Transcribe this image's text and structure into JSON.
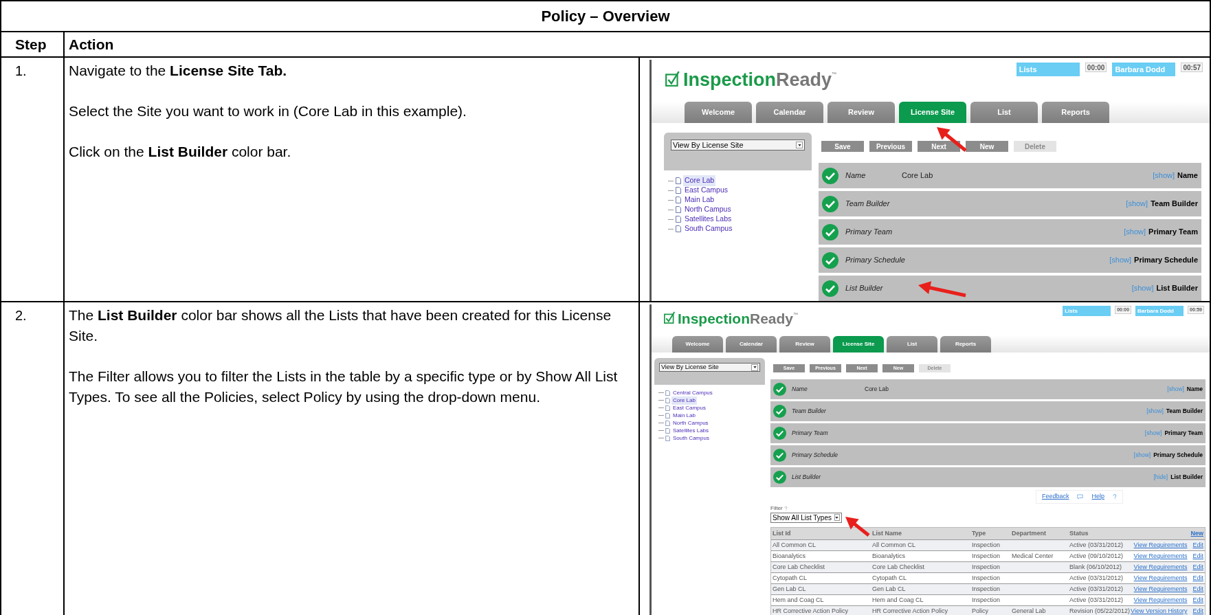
{
  "title": "Policy – Overview",
  "columns": [
    "Step",
    "Action"
  ],
  "steps": [
    {
      "number": "1.",
      "paragraphs": [
        "Navigate to the **License Site Tab.**",
        "Select the Site you want to work in (Core Lab in this example).",
        "Click on the **List Builder** color bar."
      ],
      "screenshot": {
        "logo": [
          "Inspection",
          "Ready",
          "™"
        ],
        "top_bar": [
          {
            "kind": "label",
            "text": "Lists"
          },
          {
            "kind": "timer",
            "text": "00:00"
          },
          {
            "kind": "label",
            "text": "Barbara Dodd"
          },
          {
            "kind": "timer",
            "text": "00:57"
          }
        ],
        "tabs": [
          {
            "label": "Welcome",
            "selected": false
          },
          {
            "label": "Calendar",
            "selected": false
          },
          {
            "label": "Review",
            "selected": false
          },
          {
            "label": "License Site",
            "selected": true
          },
          {
            "label": "List",
            "selected": false
          },
          {
            "label": "Reports",
            "selected": false
          }
        ],
        "view_select": "View By License Site",
        "sites": [
          {
            "label": "Core Lab",
            "selected": true
          },
          {
            "label": "East Campus",
            "selected": false
          },
          {
            "label": "Main Lab",
            "selected": false
          },
          {
            "label": "North Campus",
            "selected": false
          },
          {
            "label": "Satellites Labs",
            "selected": false
          },
          {
            "label": "South Campus",
            "selected": false
          }
        ],
        "buttons": [
          {
            "label": "Save",
            "disabled": false
          },
          {
            "label": "Previous",
            "disabled": false
          },
          {
            "label": "Next",
            "disabled": false
          },
          {
            "label": "New",
            "disabled": false
          },
          {
            "label": "Delete",
            "disabled": true
          }
        ],
        "bars": [
          {
            "label": "Name",
            "value": "Core Lab",
            "toggle": "[show]",
            "title": "Name"
          },
          {
            "label": "Team Builder",
            "toggle": "[show]",
            "title": "Team Builder"
          },
          {
            "label": "Primary Team",
            "toggle": "[show]",
            "title": "Primary Team"
          },
          {
            "label": "Primary Schedule",
            "toggle": "[show]",
            "title": "Primary Schedule"
          },
          {
            "label": "List Builder",
            "toggle": "[show]",
            "title": "List Builder"
          }
        ]
      }
    },
    {
      "number": "2.",
      "paragraphs": [
        "The **List Builder** color bar shows all the Lists that have been created for this License Site.",
        "The Filter allows you to filter the Lists in the table by a specific type or by Show All List Types.  To see all the Policies, select Policy by using the drop-down menu."
      ],
      "screenshot": {
        "logo": [
          "Inspection",
          "Ready",
          "™"
        ],
        "top_bar": [
          {
            "kind": "label",
            "text": "Lists"
          },
          {
            "kind": "timer",
            "text": "00:00"
          },
          {
            "kind": "label",
            "text": "Barbara Dodd"
          },
          {
            "kind": "timer",
            "text": "00:59"
          }
        ],
        "tabs": [
          {
            "label": "Welcome",
            "selected": false
          },
          {
            "label": "Calendar",
            "selected": false
          },
          {
            "label": "Review",
            "selected": false
          },
          {
            "label": "License Site",
            "selected": true
          },
          {
            "label": "List",
            "selected": false
          },
          {
            "label": "Reports",
            "selected": false
          }
        ],
        "view_select": "View By License Site",
        "sites": [
          {
            "label": "Central Campus",
            "selected": false
          },
          {
            "label": "Core Lab",
            "selected": true
          },
          {
            "label": "East Campus",
            "selected": false
          },
          {
            "label": "Main Lab",
            "selected": false
          },
          {
            "label": "North Campus",
            "selected": false
          },
          {
            "label": "Satellites Labs",
            "selected": false
          },
          {
            "label": "South Campus",
            "selected": false
          }
        ],
        "buttons": [
          {
            "label": "Save",
            "disabled": false
          },
          {
            "label": "Previous",
            "disabled": false
          },
          {
            "label": "Next",
            "disabled": false
          },
          {
            "label": "New",
            "disabled": false
          },
          {
            "label": "Delete",
            "disabled": true
          }
        ],
        "bars": [
          {
            "label": "Name",
            "value": "Core Lab",
            "toggle": "[show]",
            "title": "Name"
          },
          {
            "label": "Team Builder",
            "toggle": "[show]",
            "title": "Team Builder"
          },
          {
            "label": "Primary Team",
            "toggle": "[show]",
            "title": "Primary Team"
          },
          {
            "label": "Primary Schedule",
            "toggle": "[show]",
            "title": "Primary Schedule"
          },
          {
            "label": "List Builder",
            "toggle": "[hide]",
            "title": "List Builder",
            "panel": {
              "feedback": "Feedback",
              "help": "Help",
              "filter_label": "Filter",
              "filter_value": "Show All List Types",
              "columns": [
                "List Id",
                "List Name",
                "Type",
                "Department",
                "Status"
              ],
              "new_link": "New",
              "rows": [
                {
                  "list_id": "All Common CL",
                  "list_name": "All Common CL",
                  "type": "Inspection",
                  "status": "Active (03/31/2012)",
                  "links": [
                    "View Requirements",
                    "Edit"
                  ]
                },
                {
                  "list_id": "Bioanalytics",
                  "list_name": "Bioanalytics",
                  "type": "Inspection",
                  "department": "Medical Center",
                  "status": "Active (09/10/2012)",
                  "links": [
                    "View Requirements",
                    "Edit"
                  ]
                },
                {
                  "list_id": "Core Lab Checklist",
                  "list_name": "Core Lab Checklist",
                  "type": "Inspection",
                  "status": "Blank (06/10/2012)",
                  "links": [
                    "View Requirements",
                    "Edit"
                  ]
                },
                {
                  "list_id": "Cytopath CL",
                  "list_name": "Cytopath CL",
                  "type": "Inspection",
                  "status": "Active (03/31/2012)",
                  "links": [
                    "View Requirements",
                    "Edit"
                  ]
                },
                {
                  "list_id": "Gen Lab CL",
                  "list_name": "Gen Lab CL",
                  "type": "Inspection",
                  "status": "Active (03/31/2012)",
                  "links": [
                    "View Requirements",
                    "Edit"
                  ]
                },
                {
                  "list_id": "Hem and Coag CL",
                  "list_name": "Hem and Coag CL",
                  "type": "Inspection",
                  "status": "Active (03/31/2012)",
                  "links": [
                    "View Requirements",
                    "Edit"
                  ]
                },
                {
                  "list_id": "HR Corrective Action Policy",
                  "list_name": "HR Corrective Action Policy",
                  "type": "Policy",
                  "department": "General Lab",
                  "status": "Revision (05/22/2012)",
                  "links": [
                    "View Version History",
                    "Edit"
                  ]
                }
              ]
            }
          }
        ]
      }
    }
  ]
}
